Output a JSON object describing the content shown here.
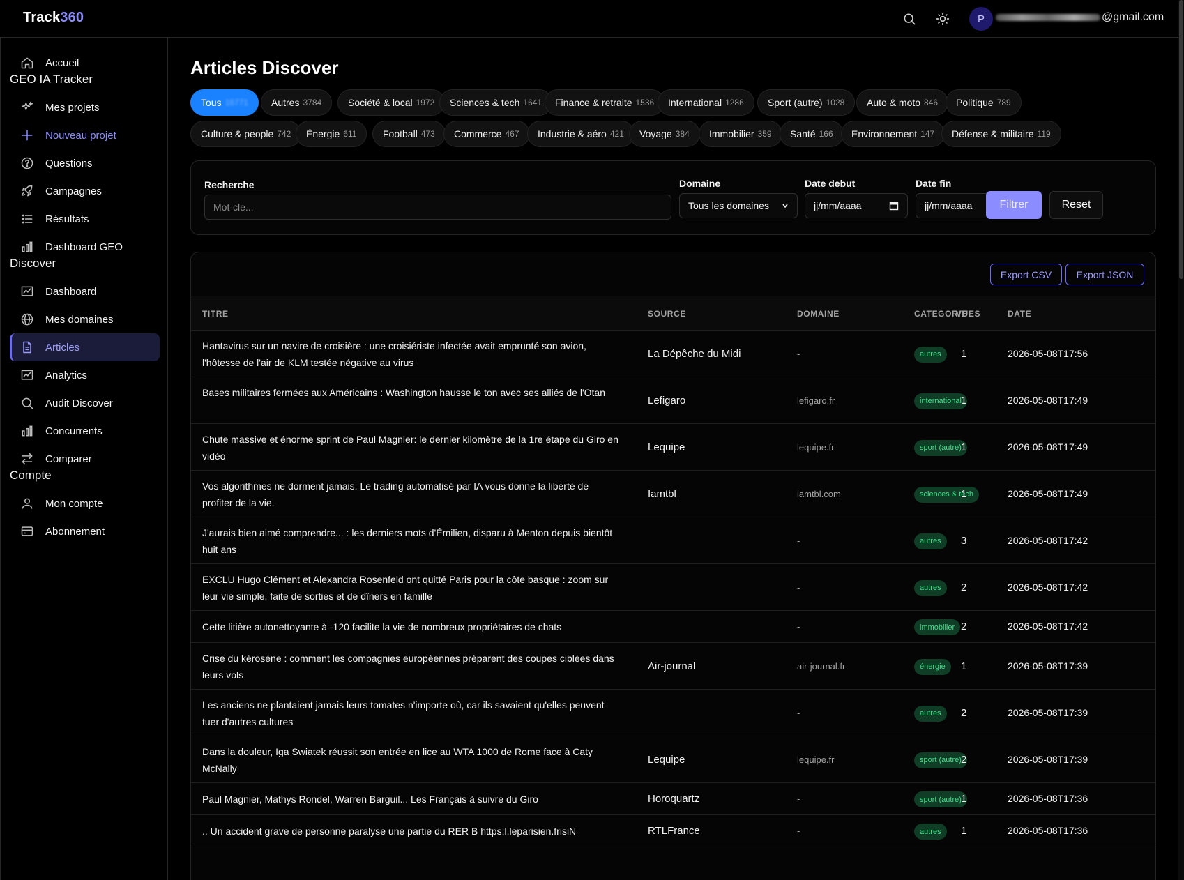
{
  "app": {
    "brand_part1": "Track",
    "brand_part2": "360",
    "user_initial": "P",
    "user_email_suffix": "@gmail.com"
  },
  "sidebar": {
    "items_top": [
      {
        "label": "Accueil",
        "icon": "home-icon"
      }
    ],
    "section_geo": "GEO IA Tracker",
    "items_geo": [
      {
        "label": "Mes projets",
        "icon": "sparkles-icon"
      },
      {
        "label": "Nouveau projet",
        "icon": "plus-icon"
      },
      {
        "label": "Questions",
        "icon": "help-circle-icon"
      },
      {
        "label": "Campagnes",
        "icon": "rocket-icon"
      },
      {
        "label": "Résultats",
        "icon": "list-icon"
      },
      {
        "label": "Dashboard GEO",
        "icon": "bar-chart-icon"
      }
    ],
    "section_discover": "Discover",
    "items_discover": [
      {
        "label": "Dashboard",
        "icon": "chart-board-icon"
      },
      {
        "label": "Mes domaines",
        "icon": "globe-icon"
      },
      {
        "label": "Articles",
        "icon": "file-text-icon"
      },
      {
        "label": "Analytics",
        "icon": "chart-board-icon"
      },
      {
        "label": "Audit Discover",
        "icon": "search-icon"
      },
      {
        "label": "Concurrents",
        "icon": "bar-chart-icon"
      },
      {
        "label": "Comparer",
        "icon": "arrows-icon"
      }
    ],
    "section_account": "Compte",
    "items_account": [
      {
        "label": "Mon compte",
        "icon": "user-icon"
      },
      {
        "label": "Abonnement",
        "icon": "credit-card-icon"
      }
    ]
  },
  "main": {
    "title": "Articles Discover",
    "categories": [
      {
        "label": "Tous",
        "count": "16771"
      },
      {
        "label": "Autres",
        "count": "3784"
      },
      {
        "label": "Société & local",
        "count": "1972"
      },
      {
        "label": "Sciences & tech",
        "count": "1641"
      },
      {
        "label": "Finance & retraite",
        "count": "1536"
      },
      {
        "label": "International",
        "count": "1286"
      },
      {
        "label": "Sport (autre)",
        "count": "1028"
      },
      {
        "label": "Auto & moto",
        "count": "846"
      },
      {
        "label": "Politique",
        "count": "789"
      },
      {
        "label": "Culture & people",
        "count": "742"
      },
      {
        "label": "Énergie",
        "count": "611"
      },
      {
        "label": "Football",
        "count": "473"
      },
      {
        "label": "Commerce",
        "count": "467"
      },
      {
        "label": "Industrie & aéro",
        "count": "421"
      },
      {
        "label": "Voyage",
        "count": "384"
      },
      {
        "label": "Immobilier",
        "count": "359"
      },
      {
        "label": "Santé",
        "count": "166"
      },
      {
        "label": "Environnement",
        "count": "147"
      },
      {
        "label": "Défense & militaire",
        "count": "119"
      }
    ],
    "filters": {
      "search_label": "Recherche",
      "search_placeholder": "Mot-cle...",
      "domain_label": "Domaine",
      "domain_value": "Tous les domaines",
      "date_start_label": "Date debut",
      "date_start_value": "jj/mm/aaaa",
      "date_end_label": "Date fin",
      "date_end_value": "jj/mm/aaaa",
      "filter_button": "Filtrer",
      "reset_button": "Reset"
    },
    "export_csv": "Export CSV",
    "export_json": "Export JSON",
    "table": {
      "headers": {
        "title": "TITRE",
        "source": "SOURCE",
        "domain": "DOMAINE",
        "category": "CATEGORIE",
        "views": "VUES",
        "date": "DATE"
      },
      "rows": [
        {
          "title": "Hantavirus sur un navire de croisière : une croisiériste infectée avait emprunté son avion, l'hôtesse de l'air de KLM testée négative au virus",
          "source": "La Dépêche du Midi",
          "domain": "-",
          "category": "autres",
          "views": "1",
          "date": "2026-05-08T17:56"
        },
        {
          "title": "Bases militaires fermées aux Américains : Washington hausse le ton avec ses alliés de l'Otan",
          "source": "Lefigaro",
          "domain": "lefigaro.fr",
          "category": "international",
          "views": "1",
          "date": "2026-05-08T17:49"
        },
        {
          "title": "Chute massive et énorme sprint de Paul Magnier: le dernier kilomètre de la 1re étape du Giro en vidéo",
          "source": "Lequipe",
          "domain": "lequipe.fr",
          "category": "sport (autre)",
          "views": "1",
          "date": "2026-05-08T17:49"
        },
        {
          "title": "Vos algorithmes ne dorment jamais. Le trading automatisé par IA vous donne la liberté de profiter de la vie.",
          "source": "Iamtbl",
          "domain": "iamtbl.com",
          "category": "sciences & tech",
          "views": "1",
          "date": "2026-05-08T17:49"
        },
        {
          "title": "J'aurais bien aimé comprendre... : les derniers mots d'Émilien, disparu à Menton depuis bientôt huit ans",
          "source": "",
          "domain": "-",
          "category": "autres",
          "views": "3",
          "date": "2026-05-08T17:42"
        },
        {
          "title": "EXCLU Hugo Clément et Alexandra Rosenfeld ont quitté Paris pour la côte basque : zoom sur leur vie simple, faite de sorties et de dîners en famille",
          "source": "",
          "domain": "-",
          "category": "autres",
          "views": "2",
          "date": "2026-05-08T17:42"
        },
        {
          "title": "Cette litière autonettoyante à -120 facilite la vie de nombreux propriétaires de chats",
          "source": "",
          "domain": "-",
          "category": "immobilier",
          "views": "2",
          "date": "2026-05-08T17:42"
        },
        {
          "title": "Crise du kérosène : comment les compagnies européennes préparent des coupes ciblées dans leurs vols",
          "source": "Air-journal",
          "domain": "air-journal.fr",
          "category": "énergie",
          "views": "1",
          "date": "2026-05-08T17:39"
        },
        {
          "title": "Les anciens ne plantaient jamais leurs tomates n'importe où, car ils savaient qu'elles peuvent tuer d'autres cultures",
          "source": "",
          "domain": "-",
          "category": "autres",
          "views": "2",
          "date": "2026-05-08T17:39"
        },
        {
          "title": "Dans la douleur, Iga Swiatek réussit son entrée en lice au WTA 1000 de Rome face à Caty McNally",
          "source": "Lequipe",
          "domain": "lequipe.fr",
          "category": "sport (autre)",
          "views": "2",
          "date": "2026-05-08T17:39"
        },
        {
          "title": "Paul Magnier, Mathys Rondel, Warren Barguil... Les Français à suivre du Giro",
          "source": "Horoquartz",
          "domain": "-",
          "category": "sport (autre)",
          "views": "1",
          "date": "2026-05-08T17:36"
        },
        {
          "title": ".. Un accident grave de personne paralyse une partie du RER B https:l.leparisien.frisiN",
          "source": "RTLFrance",
          "domain": "-",
          "category": "autres",
          "views": "1",
          "date": "2026-05-08T17:36"
        }
      ]
    }
  }
}
